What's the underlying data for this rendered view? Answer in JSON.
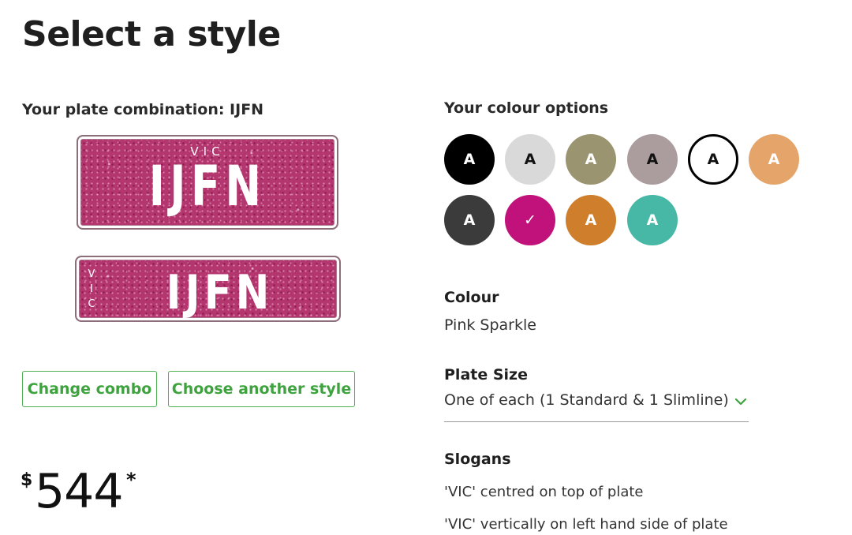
{
  "page": {
    "title": "Select a style"
  },
  "plate": {
    "combination_label": "Your plate combination: IJFN",
    "combination": "IJFN",
    "state": "VIC",
    "state_vertical": [
      "V",
      "I",
      "C"
    ]
  },
  "buttons": {
    "change_combo": "Change combo",
    "choose_style": "Choose another style"
  },
  "price": {
    "currency": "$",
    "amount": "544",
    "asterisk": "*"
  },
  "colours": {
    "heading": "Your colour options",
    "swatch_label": "A",
    "selected_mark": "✓",
    "options": [
      {
        "bg": "#000000",
        "fg": "#ffffff",
        "border": "none"
      },
      {
        "bg": "#d9d9d9",
        "fg": "#111111",
        "border": "none"
      },
      {
        "bg": "#9a9470",
        "fg": "#ffffff",
        "border": "none"
      },
      {
        "bg": "#ab9d9d",
        "fg": "#111111",
        "border": "none"
      },
      {
        "bg": "#ffffff",
        "fg": "#111111",
        "border": "#000000"
      },
      {
        "bg": "#e5a46a",
        "fg": "#ffffff",
        "border": "none"
      },
      {
        "bg": "#3b3b3b",
        "fg": "#ffffff",
        "border": "none"
      },
      {
        "bg": "#c0127a",
        "fg": "#ffffff",
        "border": "none",
        "selected": true
      },
      {
        "bg": "#cf7f2c",
        "fg": "#ffffff",
        "border": "none"
      },
      {
        "bg": "#47b8a5",
        "fg": "#ffffff",
        "border": "none"
      }
    ]
  },
  "colour": {
    "label": "Colour",
    "value": "Pink Sparkle"
  },
  "plate_size": {
    "label": "Plate Size",
    "value": "One of each (1 Standard & 1 Slimline)"
  },
  "slogans": {
    "label": "Slogans",
    "items": [
      "'VIC' centred on top of plate",
      "'VIC' vertically on left hand side of plate"
    ]
  },
  "theme": {
    "accent": "#3ea33f",
    "plate_pink": "#b4366f"
  }
}
